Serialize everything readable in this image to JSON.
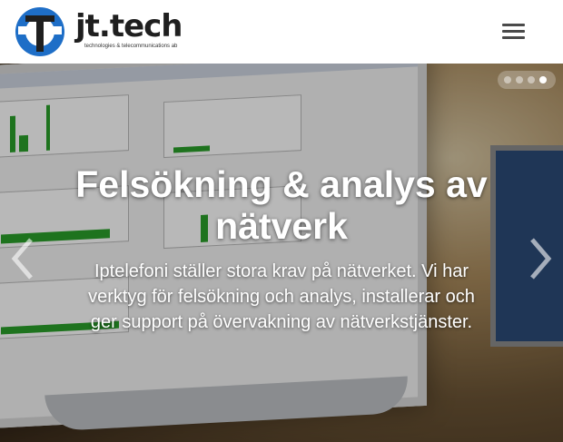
{
  "brand": {
    "name": "jt.tech",
    "tagline": "technologies & telecommunications ab",
    "accent": "#1e6ec7"
  },
  "header": {
    "menu_icon": "hamburger-icon"
  },
  "slider": {
    "title": "Felsökning & analys av nätverk",
    "text": "Iptelefoni ställer stora krav på nätverket. Vi har verktyg för felsökning och analys, installerar och ger support på övervakning av nätverkstjänster.",
    "prev_icon": "chevron-left-icon",
    "next_icon": "chevron-right-icon",
    "slide_count": 4,
    "active_index": 3
  }
}
